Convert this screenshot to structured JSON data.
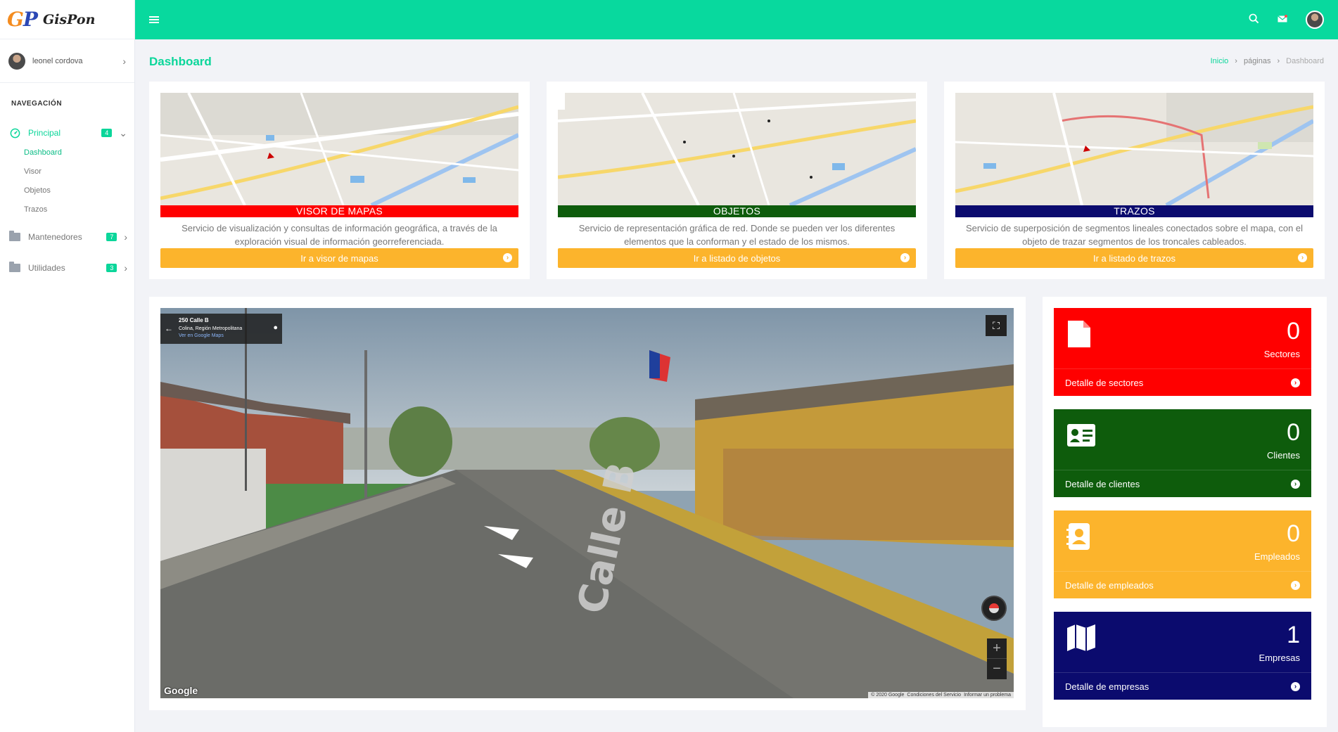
{
  "app": {
    "logo_initials_g": "G",
    "logo_initials_p": "P",
    "logo_name": "GisPon"
  },
  "sidebar": {
    "user_name": "leonel cordova",
    "nav_title": "NAVEGACIÓN",
    "principal": {
      "label": "Principal",
      "badge": "4"
    },
    "principal_items": [
      "Dashboard",
      "Visor",
      "Objetos",
      "Trazos"
    ],
    "mantenedores": {
      "label": "Mantenedores",
      "badge": "7"
    },
    "utilidades": {
      "label": "Utilidades",
      "badge": "3"
    }
  },
  "header": {
    "title": "Dashboard",
    "breadcrumb": [
      "Inicio",
      "páginas",
      "Dashboard"
    ]
  },
  "cards": [
    {
      "title": "VISOR DE MAPAS",
      "color": "#ff0000",
      "description": "Servicio de visualización y consultas de información geográfica, a través de la exploración visual de información georreferenciada.",
      "button": "Ir a visor de mapas"
    },
    {
      "title": "OBJETOS",
      "color": "#0e5c0c",
      "description": "Servicio de representación gráfica de red. Donde se pueden ver los diferentes elementos que la conforman y el estado de los mismos.",
      "button": "Ir a listado de objetos"
    },
    {
      "title": "TRAZOS",
      "color": "#0b0b6e",
      "description": "Servicio de superposición de segmentos lineales conectados sobre el mapa, con el objeto de trazar segmentos de los troncales cableados.",
      "button": "Ir a listado de trazos"
    }
  ],
  "streetview": {
    "address": "250 Calle B",
    "region": "Colina, Región Metropolitana",
    "maps_link": "Ver en Google Maps",
    "google_logo": "Google",
    "credits": [
      "© 2020 Google",
      "Condiciones del Servicio",
      "Informar un problema"
    ],
    "street_label": "Calle B"
  },
  "stats": [
    {
      "value": "0",
      "label": "Sectores",
      "link": "Detalle de sectores",
      "color": "#ff0000",
      "icon": "file-icon"
    },
    {
      "value": "0",
      "label": "Clientes",
      "link": "Detalle de clientes",
      "color": "#0e5c0c",
      "icon": "id-card-icon"
    },
    {
      "value": "0",
      "label": "Empleados",
      "link": "Detalle de empleados",
      "color": "#fcb42c",
      "icon": "contact-book-icon"
    },
    {
      "value": "1",
      "label": "Empresas",
      "link": "Detalle de empresas",
      "color": "#0b0b6e",
      "icon": "map-icon"
    }
  ],
  "colors": {
    "accent": "#08d99e",
    "button": "#fcb42c"
  }
}
